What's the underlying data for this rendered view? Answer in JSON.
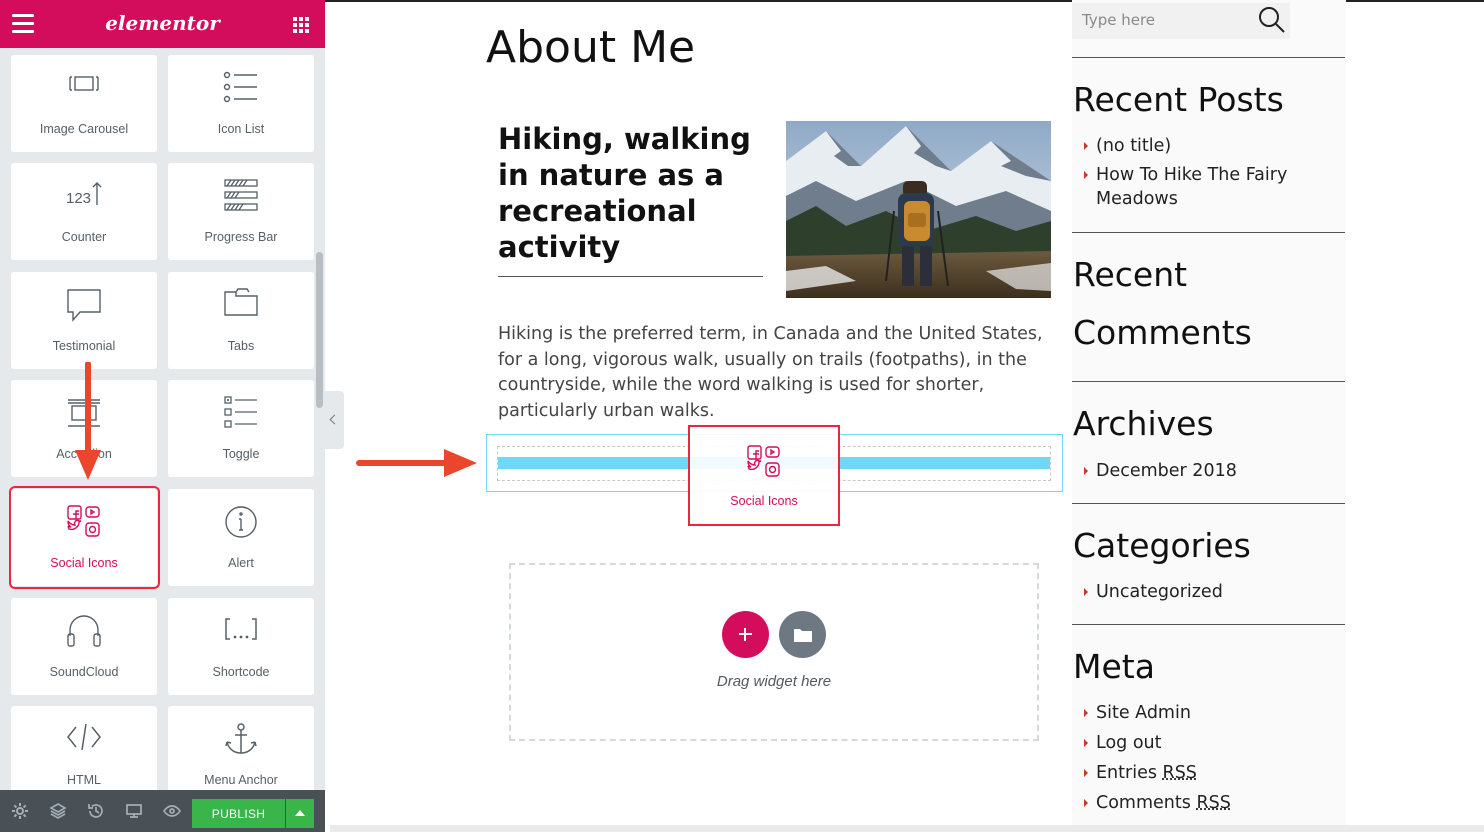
{
  "panel": {
    "brand": "elementor",
    "widgets": [
      {
        "label": "Image Carousel",
        "icon": "image-carousel-icon"
      },
      {
        "label": "Icon List",
        "icon": "icon-list-icon"
      },
      {
        "label": "Counter",
        "icon": "counter-icon"
      },
      {
        "label": "Progress Bar",
        "icon": "progress-bar-icon"
      },
      {
        "label": "Testimonial",
        "icon": "testimonial-icon"
      },
      {
        "label": "Tabs",
        "icon": "tabs-icon"
      },
      {
        "label": "Accordion",
        "icon": "accordion-icon"
      },
      {
        "label": "Toggle",
        "icon": "toggle-icon"
      },
      {
        "label": "Social Icons",
        "icon": "social-icons-icon"
      },
      {
        "label": "Alert",
        "icon": "alert-icon"
      },
      {
        "label": "SoundCloud",
        "icon": "soundcloud-icon"
      },
      {
        "label": "Shortcode",
        "icon": "shortcode-icon"
      },
      {
        "label": "HTML",
        "icon": "html-icon"
      },
      {
        "label": "Menu Anchor",
        "icon": "menu-anchor-icon"
      }
    ],
    "footer": {
      "publish_label": "PUBLISH"
    }
  },
  "colors": {
    "brand": "#d30c5c",
    "highlight": "#e8283c",
    "drop_indicator": "#71d7f7",
    "publish": "#39b54a",
    "footer": "#495157"
  },
  "canvas": {
    "page_title": "About Me",
    "post_heading": "Hiking, walking in nature as a recreational activity",
    "post_body": "Hiking is the preferred term, in Canada and the United States, for a long, vigorous walk, usually on trails (footpaths), in the countryside, while the word walking is used for shorter, particularly urban walks.",
    "drag_ghost_label": "Social Icons",
    "drag_hint": "Drag widget here"
  },
  "sidebar": {
    "search_placeholder": "Type here",
    "recent_posts_title": "Recent Posts",
    "recent_posts": [
      "(no title)",
      "How To Hike The Fairy Meadows"
    ],
    "recent_comments_title_1": "Recent",
    "recent_comments_title_2": "Comments",
    "archives_title": "Archives",
    "archives": [
      "December 2018"
    ],
    "categories_title": "Categories",
    "categories": [
      "Uncategorized"
    ],
    "meta_title": "Meta",
    "meta": {
      "site_admin": "Site Admin",
      "log_out": "Log out",
      "entries": "Entries",
      "comments": "Comments",
      "rss": "RSS"
    }
  }
}
